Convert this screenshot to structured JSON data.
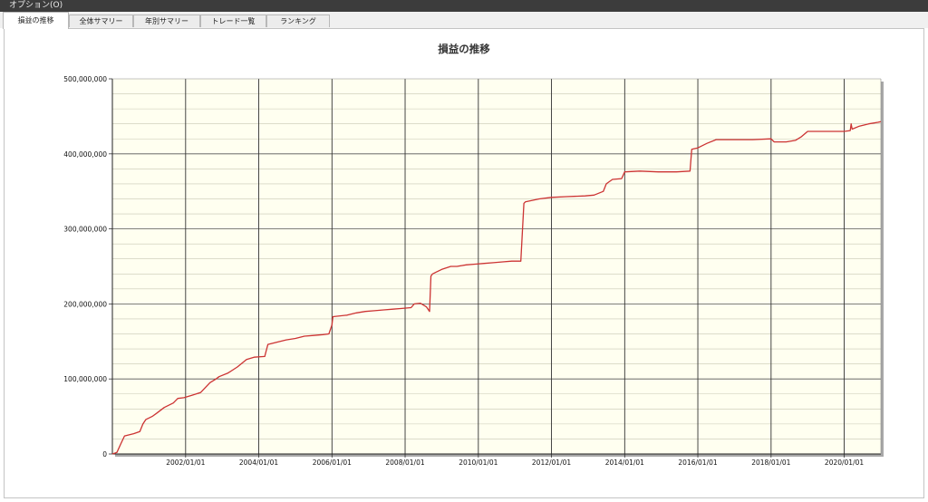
{
  "menubar": {
    "label": "オプション(O)"
  },
  "tabs": [
    {
      "label": "損益の推移"
    },
    {
      "label": "全体サマリー"
    },
    {
      "label": "年別サマリー"
    },
    {
      "label": "トレード一覧"
    },
    {
      "label": "ランキング"
    }
  ],
  "chart_data": {
    "type": "line",
    "title": "損益の推移",
    "xlabel": "",
    "ylabel": "",
    "ylim": [
      0,
      500000000
    ],
    "xlim": [
      "2000-01-01",
      "2021-01-01"
    ],
    "grid": true,
    "plot_background": "#fffff0",
    "line_color": "#cc3333",
    "y_tick_labels": [
      "0",
      "100,000,000",
      "200,000,000",
      "300,000,000",
      "400,000,000",
      "500,000,000"
    ],
    "y_ticks": [
      0,
      100000000,
      200000000,
      300000000,
      400000000,
      500000000
    ],
    "x_tick_labels": [
      "2002/01/01",
      "2004/01/01",
      "2006/01/01",
      "2008/01/01",
      "2010/01/01",
      "2012/01/01",
      "2014/01/01",
      "2016/01/01",
      "2018/01/01",
      "2020/01/01"
    ],
    "series": [
      {
        "x": [
          "2000-01-01",
          "2000-02-15",
          "2000-03-20",
          "2000-05-01",
          "2000-08-01",
          "2000-10-01",
          "2000-11-01",
          "2000-12-01",
          "2001-02-01",
          "2001-03-15",
          "2001-06-01",
          "2001-09-01",
          "2001-10-15",
          "2001-12-15",
          "2002-03-01",
          "2002-06-01",
          "2002-09-01",
          "2002-11-01",
          "2002-12-01",
          "2003-03-01",
          "2003-06-01",
          "2003-09-01",
          "2003-11-15",
          "2004-03-01",
          "2004-04-01",
          "2004-07-01",
          "2004-10-01",
          "2005-01-01",
          "2005-04-01",
          "2005-07-01",
          "2005-10-01",
          "2005-12-01",
          "2006-01-01",
          "2006-01-10",
          "2006-06-01",
          "2006-09-01",
          "2006-12-01",
          "2007-03-01",
          "2007-06-01",
          "2007-09-01",
          "2007-12-01",
          "2008-03-01",
          "2008-04-01",
          "2008-06-01",
          "2008-08-01",
          "2008-09-01",
          "2008-09-15",
          "2008-10-01",
          "2008-11-01",
          "2009-01-01",
          "2009-04-01",
          "2009-06-01",
          "2009-09-01",
          "2009-12-01",
          "2010-03-01",
          "2010-06-01",
          "2010-09-01",
          "2010-12-01",
          "2011-03-01",
          "2011-04-01",
          "2011-04-15",
          "2011-09-01",
          "2012-01-01",
          "2012-06-01",
          "2012-12-01",
          "2013-03-01",
          "2013-06-01",
          "2013-07-01",
          "2013-09-01",
          "2013-12-01",
          "2014-01-01",
          "2014-06-01",
          "2014-12-01",
          "2015-06-01",
          "2015-10-15",
          "2015-11-01",
          "2016-01-01",
          "2016-04-01",
          "2016-07-01",
          "2017-01-01",
          "2017-07-01",
          "2018-01-01",
          "2018-02-01",
          "2018-06-01",
          "2018-09-01",
          "2018-11-01",
          "2019-01-01",
          "2019-06-01",
          "2019-12-01",
          "2020-01-01",
          "2020-03-01",
          "2020-03-10",
          "2020-03-20",
          "2020-06-01",
          "2020-09-01",
          "2020-12-01",
          "2021-01-01"
        ],
        "y": [
          0,
          2000000,
          12000000,
          24000000,
          27000000,
          30000000,
          40000000,
          46000000,
          50000000,
          54000000,
          62000000,
          68000000,
          74000000,
          75000000,
          78000000,
          82000000,
          95000000,
          100000000,
          103000000,
          108000000,
          116000000,
          126000000,
          129000000,
          130000000,
          146000000,
          149000000,
          152000000,
          154000000,
          157000000,
          158000000,
          159000000,
          160000000,
          172000000,
          183000000,
          185000000,
          188000000,
          190000000,
          191000000,
          192000000,
          193000000,
          194000000,
          195000000,
          200000000,
          201000000,
          196000000,
          190000000,
          237000000,
          240000000,
          242000000,
          246000000,
          250000000,
          250000000,
          252000000,
          253000000,
          254000000,
          255000000,
          256000000,
          257000000,
          257000000,
          334000000,
          336000000,
          340000000,
          342000000,
          343000000,
          344000000,
          345000000,
          350000000,
          360000000,
          366000000,
          367000000,
          376000000,
          377000000,
          376000000,
          376000000,
          377000000,
          406000000,
          408000000,
          414000000,
          419000000,
          419000000,
          419000000,
          420000000,
          416000000,
          416000000,
          418000000,
          423000000,
          430000000,
          430000000,
          430000000,
          430000000,
          431000000,
          440000000,
          433000000,
          437000000,
          440000000,
          442000000,
          443000000
        ]
      }
    ]
  }
}
